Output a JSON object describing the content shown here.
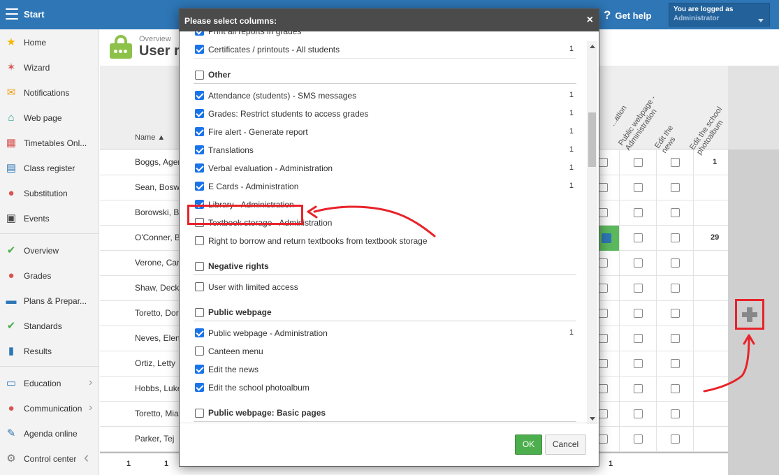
{
  "topbar": {
    "start_label": "Start",
    "help_label": "Get help",
    "user_line1": "You are logged as",
    "user_line2": "Administrator"
  },
  "sidebar": {
    "items": [
      {
        "label": "Home",
        "icon": "star-icon",
        "color": "#f5b800"
      },
      {
        "label": "Wizard",
        "icon": "magic-wand-icon",
        "color": "#d9534f"
      },
      {
        "label": "Notifications",
        "icon": "envelope-icon",
        "color": "#f0a020"
      },
      {
        "label": "Web page",
        "icon": "house-icon",
        "color": "#2a9d8f"
      },
      {
        "label": "Timetables Onl...",
        "icon": "calendar-grid-icon",
        "color": "#d9534f"
      },
      {
        "label": "Class register",
        "icon": "book-icon",
        "color": "#2e76b6"
      },
      {
        "label": "Substitution",
        "icon": "user-icon",
        "color": "#d9534f"
      },
      {
        "label": "Events",
        "icon": "calendar-icon",
        "color": "#444444"
      },
      {
        "label": "Overview",
        "icon": "check-circle-icon",
        "color": "#4cae4c"
      },
      {
        "label": "Grades",
        "icon": "grades-icon",
        "color": "#d9534f"
      },
      {
        "label": "Plans & Prepar...",
        "icon": "briefcase-icon",
        "color": "#2e76b6"
      },
      {
        "label": "Standards",
        "icon": "shield-check-icon",
        "color": "#4cae4c"
      },
      {
        "label": "Results",
        "icon": "bar-chart-icon",
        "color": "#2e76b6"
      },
      {
        "label": "Education",
        "icon": "open-book-icon",
        "color": "#2e76b6"
      },
      {
        "label": "Communication",
        "icon": "chat-icon",
        "color": "#d9534f"
      },
      {
        "label": "Agenda online",
        "icon": "pencil-icon",
        "color": "#2e76b6"
      },
      {
        "label": "Control center",
        "icon": "gear-icon",
        "color": "#777777"
      }
    ]
  },
  "header": {
    "breadcrumb": "Overview",
    "title": "User r"
  },
  "grid": {
    "name_header": "Name ▲",
    "col_headers": [
      "...ation",
      "Public webpage - Administration",
      "Edit the news",
      "Edit the school photoalbum"
    ],
    "rows": [
      {
        "name": "Boggs, Agen",
        "last": "1"
      },
      {
        "name": "Sean, Bosw",
        "last": ""
      },
      {
        "name": "Borowski, B",
        "last": ""
      },
      {
        "name": "O'Conner, B",
        "last": "29"
      },
      {
        "name": "Verone, Car",
        "last": ""
      },
      {
        "name": "Shaw, Deck",
        "last": ""
      },
      {
        "name": "Toretto, Dor",
        "last": ""
      },
      {
        "name": "Neves, Elen",
        "last": ""
      },
      {
        "name": "Ortiz, Letty",
        "last": ""
      },
      {
        "name": "Hobbs, Luke",
        "last": ""
      },
      {
        "name": "Toretto, Mia",
        "last": ""
      },
      {
        "name": "Parker, Tej",
        "last": ""
      }
    ],
    "footer": [
      "1",
      "1",
      "1"
    ]
  },
  "modal": {
    "title": "Please select columns:",
    "close": "×",
    "items": [
      {
        "type": "item",
        "label": "Print all reports in grades",
        "checked": true,
        "count": ""
      },
      {
        "type": "item",
        "label": "Certificates / printouts - All students",
        "checked": true,
        "count": "1"
      },
      {
        "type": "group",
        "label": "Other"
      },
      {
        "type": "item",
        "label": "Attendance (students) - SMS messages",
        "checked": true,
        "count": "1"
      },
      {
        "type": "item",
        "label": "Grades: Restrict students to access grades",
        "checked": true,
        "count": "1"
      },
      {
        "type": "item",
        "label": "Fire alert - Generate report",
        "checked": true,
        "count": "1"
      },
      {
        "type": "item",
        "label": "Translations",
        "checked": true,
        "count": "1"
      },
      {
        "type": "item",
        "label": "Verbal evaluation - Administration",
        "checked": true,
        "count": "1"
      },
      {
        "type": "item",
        "label": "E Cards - Administration",
        "checked": true,
        "count": "1"
      },
      {
        "type": "item",
        "label": "Library - Administration",
        "checked": true,
        "count": ""
      },
      {
        "type": "item",
        "label": "Textbook storage - Administration",
        "checked": false,
        "count": ""
      },
      {
        "type": "item",
        "label": "Right to borrow and return textbooks from textbook storage",
        "checked": false,
        "count": ""
      },
      {
        "type": "group",
        "label": "Negative rights"
      },
      {
        "type": "item",
        "label": "User with limited access",
        "checked": false,
        "count": ""
      },
      {
        "type": "group",
        "label": "Public webpage"
      },
      {
        "type": "item",
        "label": "Public webpage - Administration",
        "checked": true,
        "count": "1"
      },
      {
        "type": "item",
        "label": "Canteen menu",
        "checked": false,
        "count": ""
      },
      {
        "type": "item",
        "label": "Edit the news",
        "checked": true,
        "count": ""
      },
      {
        "type": "item",
        "label": "Edit the school photoalbum",
        "checked": true,
        "count": ""
      },
      {
        "type": "group",
        "label": "Public webpage: Basic pages"
      }
    ],
    "ok_label": "OK",
    "cancel_label": "Cancel"
  },
  "colors": {
    "topbar": "#2e76b6",
    "annotation": "#e8232a",
    "ok": "#4cae4c",
    "checkbox": "#1a73e8"
  }
}
